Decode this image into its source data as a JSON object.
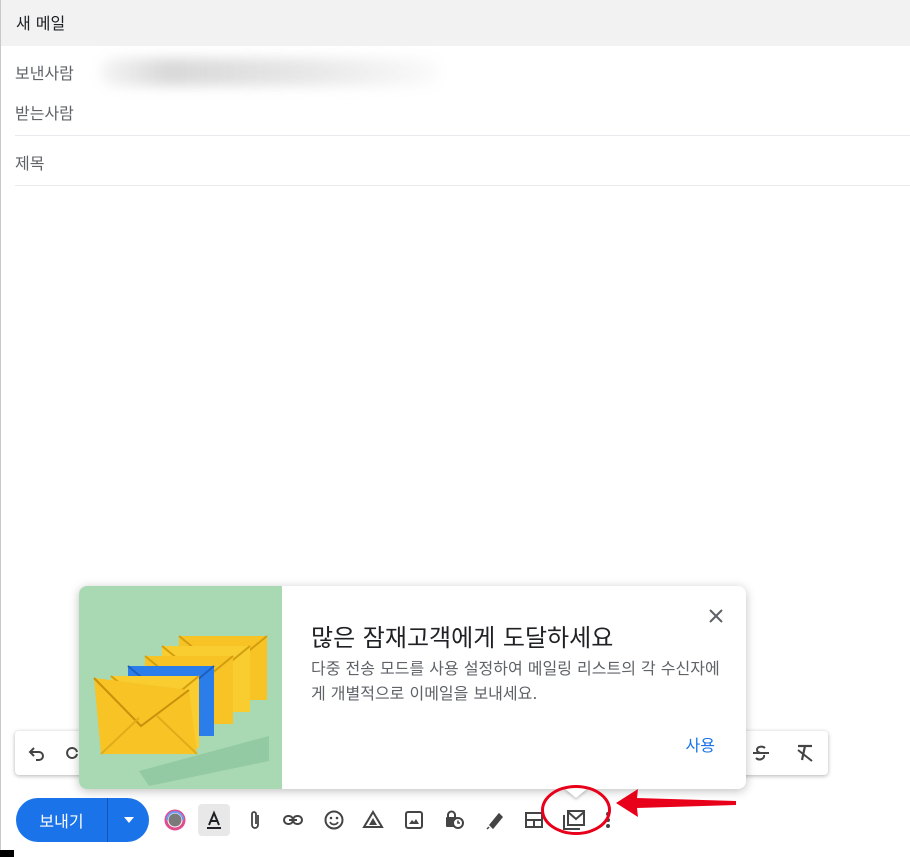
{
  "compose": {
    "title": "새 메일",
    "from_label": "보낸사람",
    "to_label": "받는사람",
    "subject_label": "제목"
  },
  "popup": {
    "title": "많은 잠재고객에게 도달하세요",
    "description": "다중 전송 모드를 사용 설정하여 메일링 리스트의 각 수신자에게 개별적으로 이메일을 보내세요.",
    "action_label": "사용",
    "illustration": "envelopes-illustration"
  },
  "toolbar": {
    "send_label": "보내기",
    "icons": [
      "layouts-icon",
      "text-format-icon",
      "attach-icon",
      "link-icon",
      "emoji-icon",
      "drive-icon",
      "photo-icon",
      "confidential-mode-icon",
      "signature-icon",
      "layout-grid-icon",
      "multi-send-icon",
      "more-options-icon"
    ]
  },
  "formatting_bar": {
    "icons": [
      "undo-icon",
      "redo-icon",
      "strikethrough-icon",
      "clear-formatting-icon"
    ]
  },
  "colors": {
    "send_blue": "#1a73e8",
    "highlight_red": "#e8001a",
    "popup_art_green": "#a8d9b3"
  }
}
